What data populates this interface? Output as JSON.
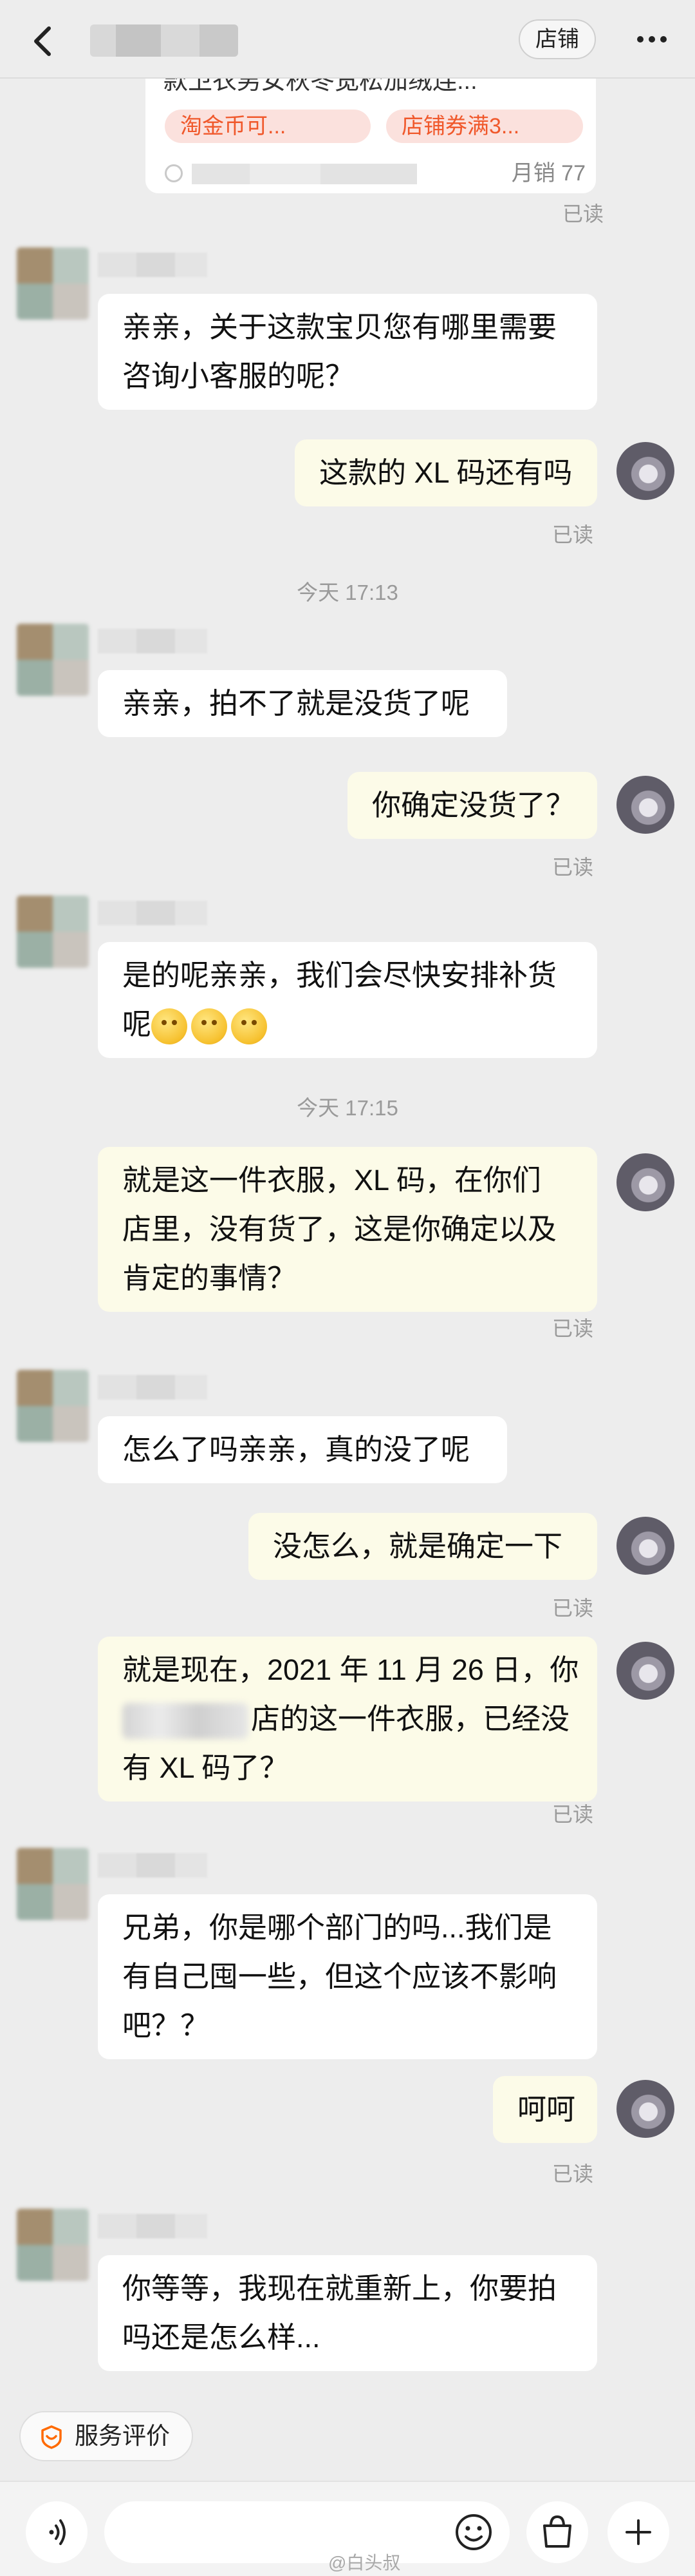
{
  "header": {
    "shop_button": "店铺",
    "back_icon": "chevron-left-icon",
    "more_icon": "ellipsis-icon"
  },
  "product_card": {
    "title": "款卫衣男女秋冬宽松加绒连...",
    "chips": [
      "淘金币可...",
      "店铺券满3..."
    ],
    "sales": "月销 77",
    "read": "已读"
  },
  "messages": [
    {
      "side": "in",
      "lines": [
        "亲亲，关于这款宝贝您有哪里需要",
        "咨询小客服的呢？"
      ]
    },
    {
      "side": "out",
      "lines": [
        "这款的 XL 码还有吗"
      ],
      "read": "已读"
    },
    {
      "timestamp": "今天 17:13"
    },
    {
      "side": "in",
      "lines": [
        "亲亲，拍不了就是没货了呢"
      ]
    },
    {
      "side": "out",
      "lines": [
        "你确定没货了？"
      ],
      "read": "已读"
    },
    {
      "side": "in",
      "lines": [
        "是的呢亲亲，我们会尽快安排补货",
        "呢"
      ],
      "emoji_count": 3
    },
    {
      "timestamp": "今天 17:15"
    },
    {
      "side": "out",
      "lines": [
        "就是这一件衣服，XL 码，在你们",
        "店里，没有货了，这是你确定以及",
        "肯定的事情？"
      ],
      "read": "已读"
    },
    {
      "side": "in",
      "lines": [
        "怎么了吗亲亲，真的没了呢"
      ]
    },
    {
      "side": "out",
      "lines": [
        "没怎么，就是确定一下"
      ],
      "read": "已读"
    },
    {
      "side": "out",
      "lines": [
        "就是现在，2021 年 11 月 26 日，你",
        "店的这一件衣服，已经没",
        "有 XL 码了？"
      ],
      "read": "已读"
    },
    {
      "side": "in",
      "lines": [
        "兄弟，你是哪个部门的吗...我们是",
        "有自己囤一些，但这个应该不影响",
        "吧？？"
      ]
    },
    {
      "side": "out",
      "lines": [
        "呵呵"
      ],
      "read": "已读"
    },
    {
      "side": "in",
      "lines": [
        "你等等，我现在就重新上，你要拍",
        "吗还是怎么样..."
      ]
    }
  ],
  "bottom": {
    "rate_button": "服务评价",
    "rate_icon": "shop-rating-icon",
    "input_placeholder": "",
    "voice_icon": "voice-icon",
    "emoji_icon": "smiley-icon",
    "bag_icon": "shopping-bag-icon",
    "plus_icon": "plus-icon",
    "watermark": "@白头叔"
  },
  "colors": {
    "background": "#ededed",
    "incoming_bubble": "#ffffff",
    "outgoing_bubble": "#fcfbe8",
    "chip_text": "#f0582b",
    "chip_bg": "#fbe1dd",
    "rate_icon": "#ff6a00"
  }
}
